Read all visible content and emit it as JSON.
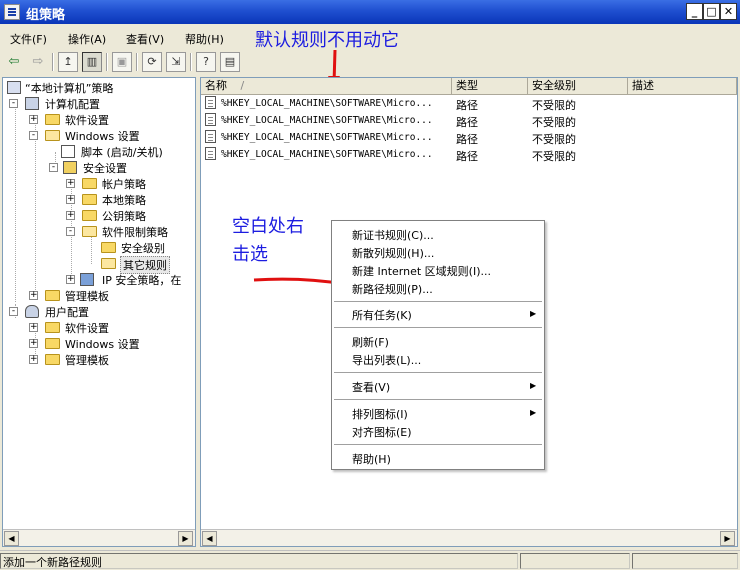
{
  "window": {
    "title": "组策略"
  },
  "menu": [
    "文件(F)",
    "操作(A)",
    "查看(V)",
    "帮助(H)"
  ],
  "annotations": {
    "top": "默认规则不用动它",
    "middle_line1": "空白处右",
    "middle_line2": "击选"
  },
  "tree": [
    {
      "label": "“本地计算机”策略",
      "level": 0,
      "icon": "policy-icon"
    },
    {
      "label": "计算机配置",
      "level": 1,
      "icon": "computer-icon",
      "expander": "-"
    },
    {
      "label": "软件设置",
      "level": 2,
      "icon": "folder-icon",
      "expander": "+"
    },
    {
      "label": "Windows 设置",
      "level": 2,
      "icon": "folder-open-icon",
      "expander": "-"
    },
    {
      "label": "脚本 (启动/关机)",
      "level": 3,
      "icon": "script-icon"
    },
    {
      "label": "安全设置",
      "level": 3,
      "icon": "security-icon",
      "expander": "-"
    },
    {
      "label": "帐户策略",
      "level": 4,
      "icon": "folder-icon",
      "expander": "+"
    },
    {
      "label": "本地策略",
      "level": 4,
      "icon": "folder-icon",
      "expander": "+"
    },
    {
      "label": "公钥策略",
      "level": 4,
      "icon": "folder-icon",
      "expander": "+"
    },
    {
      "label": "软件限制策略",
      "level": 4,
      "icon": "folder-open-icon",
      "expander": "-"
    },
    {
      "label": "安全级别",
      "level": 5,
      "icon": "folder-icon"
    },
    {
      "label": "其它规则",
      "level": 5,
      "icon": "folder-open-icon",
      "selected": true
    },
    {
      "label": "IP 安全策略，在",
      "level": 4,
      "icon": "ipsec-icon",
      "expander": "+"
    },
    {
      "label": "管理模板",
      "level": 2,
      "icon": "folder-icon",
      "expander": "+"
    },
    {
      "label": "用户配置",
      "level": 1,
      "icon": "user-icon",
      "expander": "-"
    },
    {
      "label": "软件设置",
      "level": 2,
      "icon": "folder-icon",
      "expander": "+"
    },
    {
      "label": "Windows 设置",
      "level": 2,
      "icon": "folder-icon",
      "expander": "+"
    },
    {
      "label": "管理模板",
      "level": 2,
      "icon": "folder-icon",
      "expander": "+"
    }
  ],
  "list": {
    "columns": [
      "名称",
      "类型",
      "安全级别",
      "描述"
    ],
    "rows": [
      {
        "name": "%HKEY_LOCAL_MACHINE\\SOFTWARE\\Micro...",
        "type": "路径",
        "level": "不受限的",
        "desc": ""
      },
      {
        "name": "%HKEY_LOCAL_MACHINE\\SOFTWARE\\Micro...",
        "type": "路径",
        "level": "不受限的",
        "desc": ""
      },
      {
        "name": "%HKEY_LOCAL_MACHINE\\SOFTWARE\\Micro...",
        "type": "路径",
        "level": "不受限的",
        "desc": ""
      },
      {
        "name": "%HKEY_LOCAL_MACHINE\\SOFTWARE\\Micro...",
        "type": "路径",
        "level": "不受限的",
        "desc": ""
      }
    ]
  },
  "context_menu": {
    "items": [
      {
        "label": "新证书规则(C)...",
        "submenu": false
      },
      {
        "label": "新散列规则(H)...",
        "submenu": false
      },
      {
        "label": "新建 Internet 区域规则(I)...",
        "submenu": false
      },
      {
        "label": "新路径规则(P)...",
        "submenu": false
      },
      {
        "label": "所有任务(K)",
        "submenu": true
      },
      {
        "label": "刷新(F)",
        "submenu": false
      },
      {
        "label": "导出列表(L)...",
        "submenu": false
      },
      {
        "label": "查看(V)",
        "submenu": true
      },
      {
        "label": "排列图标(I)",
        "submenu": true
      },
      {
        "label": "对齐图标(E)",
        "submenu": false
      },
      {
        "label": "帮助(H)",
        "submenu": false
      }
    ]
  },
  "status": {
    "text": "添加一个新路径规则"
  },
  "colors": {
    "title_bar": "#1f4fd0",
    "annotation": "#1c1ce0",
    "arrow": "#e01010"
  }
}
